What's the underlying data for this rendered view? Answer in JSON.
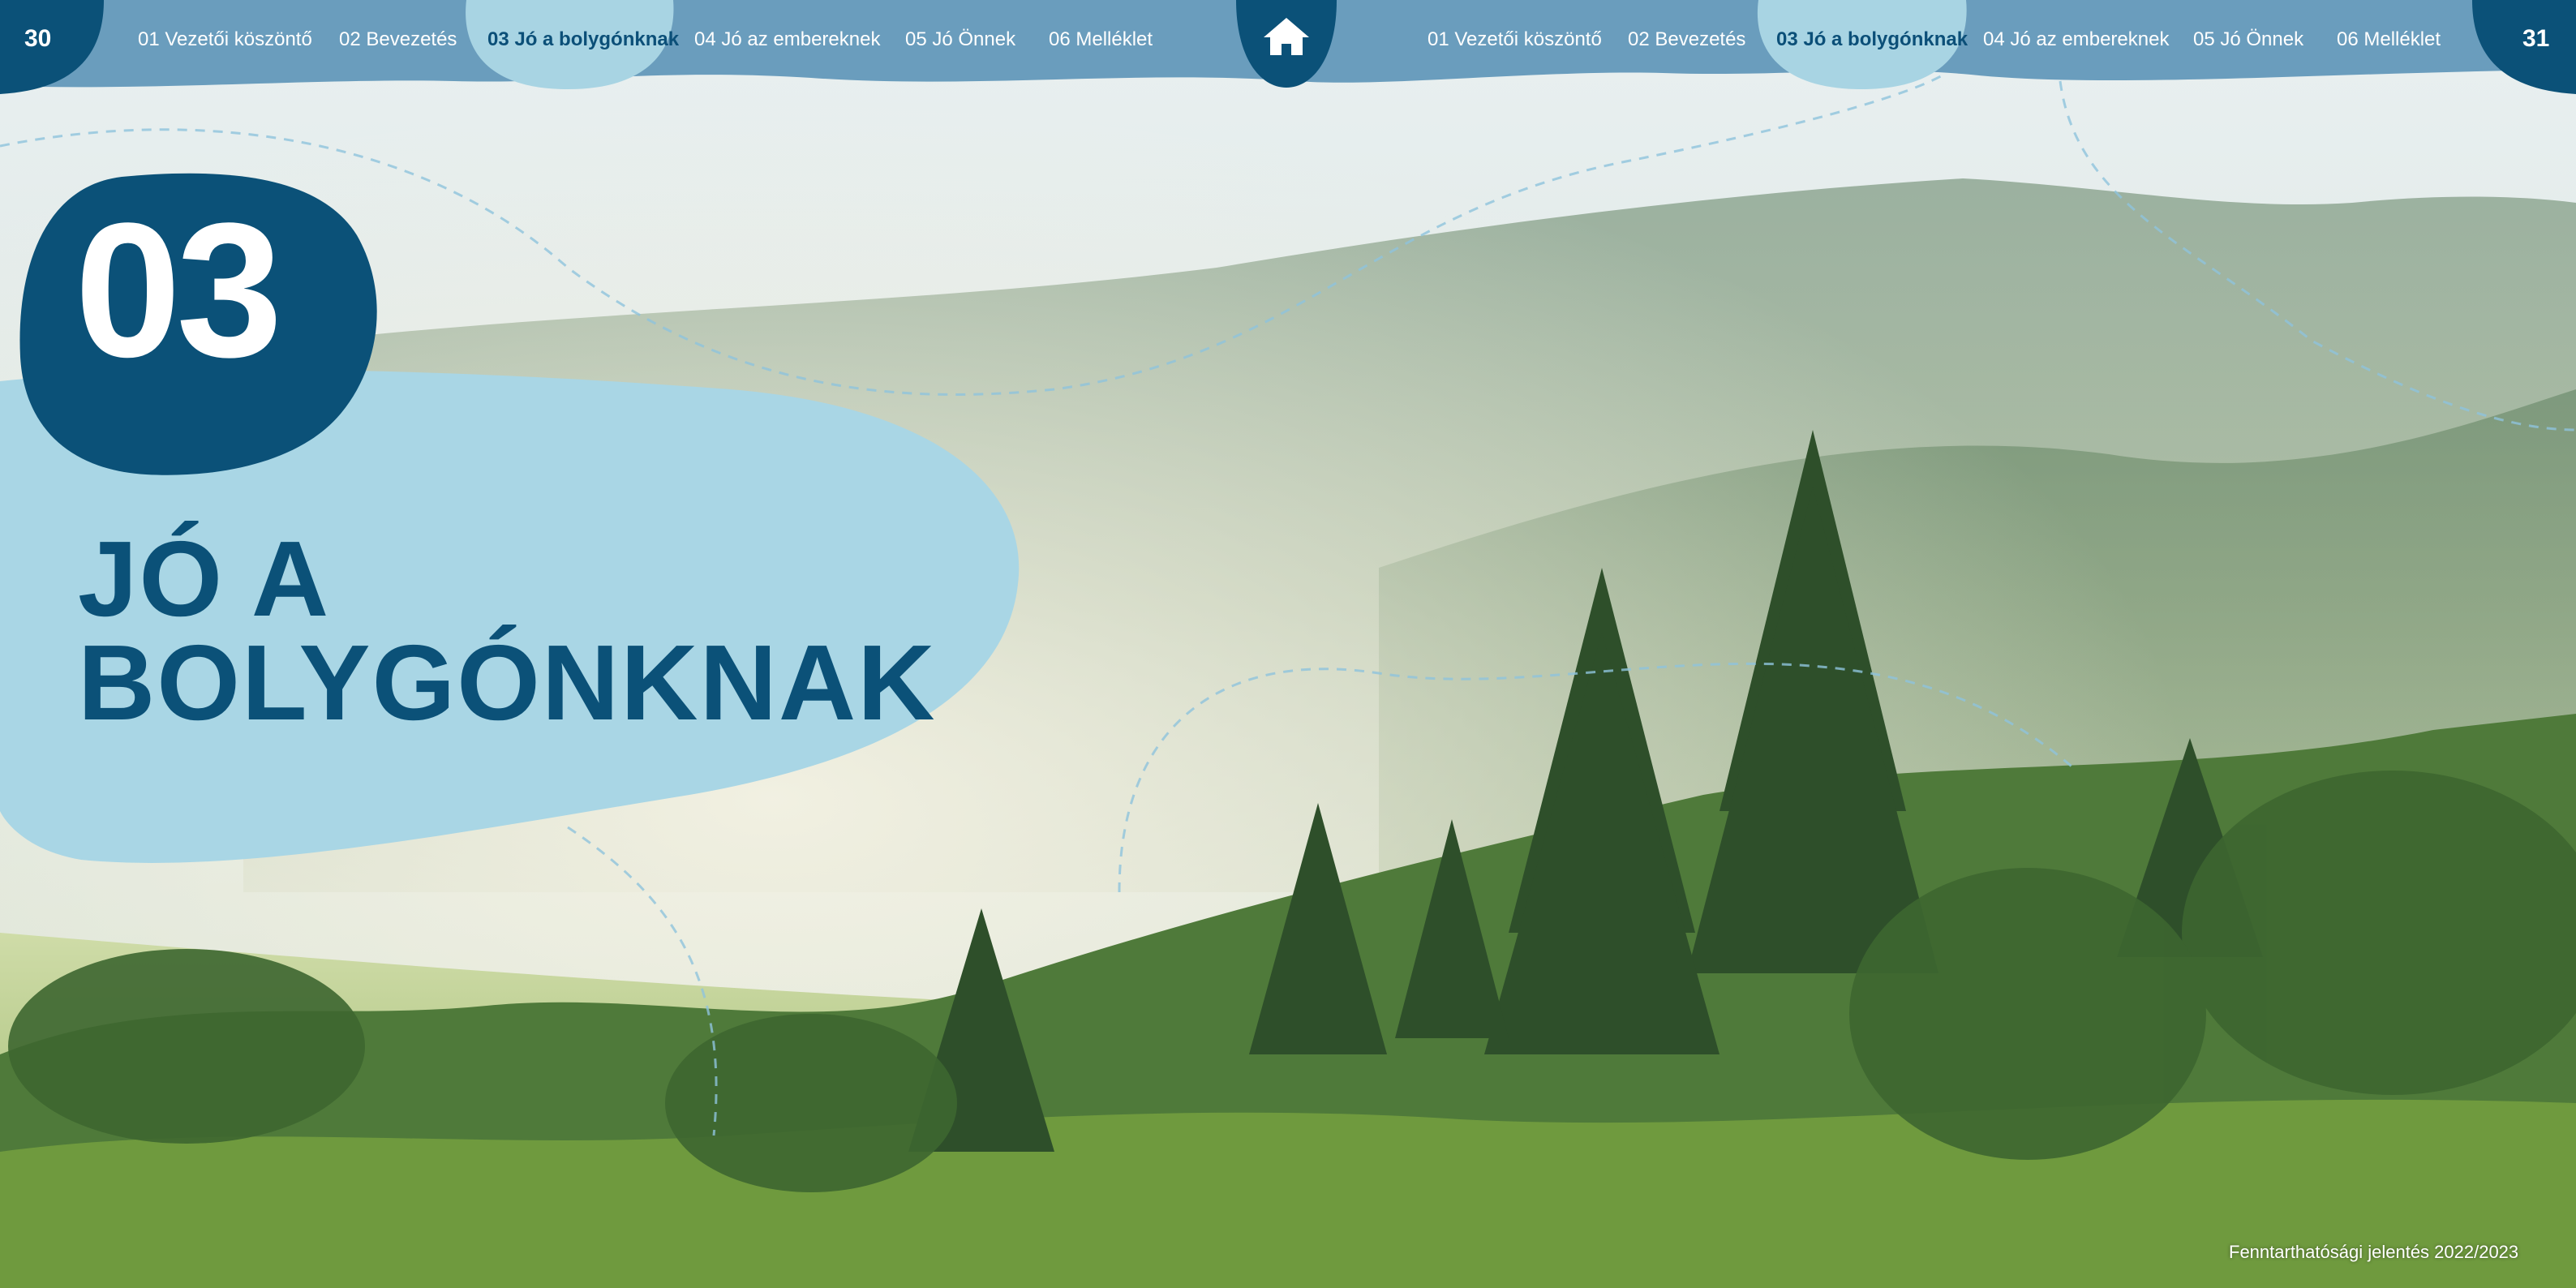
{
  "nav_left": {
    "page_number": "30",
    "items": [
      {
        "label": "01 Vezetői köszöntő",
        "active": false
      },
      {
        "label": "02 Bevezetés",
        "active": false
      },
      {
        "label": "03 Jó a bolygónknak",
        "active": true
      },
      {
        "label": "04 Jó az embereknek",
        "active": false
      },
      {
        "label": "05 Jó Önnek",
        "active": false
      },
      {
        "label": "06 Melléklet",
        "active": false
      }
    ]
  },
  "nav_right": {
    "page_number": "31",
    "items": [
      {
        "label": "01 Vezetői köszöntő",
        "active": false
      },
      {
        "label": "02 Bevezetés",
        "active": false
      },
      {
        "label": "03 Jó a bolygónknak",
        "active": true
      },
      {
        "label": "04 Jó az embereknek",
        "active": false
      },
      {
        "label": "05 Jó Önnek",
        "active": false
      },
      {
        "label": "06 Melléklet",
        "active": false
      }
    ]
  },
  "home": {
    "icon": "home-icon"
  },
  "chapter": {
    "number": "03",
    "title_line1": "JÓ A",
    "title_line2": "BOLYGÓNKNAK"
  },
  "footer": {
    "text": "Fenntarthatósági jelentés 2022/2023"
  },
  "colors": {
    "nav_bar": "#6a9dbd",
    "nav_active_pill": "#a8d4e3",
    "dark_blue": "#0b5178",
    "light_blue": "#a9d6e5"
  }
}
